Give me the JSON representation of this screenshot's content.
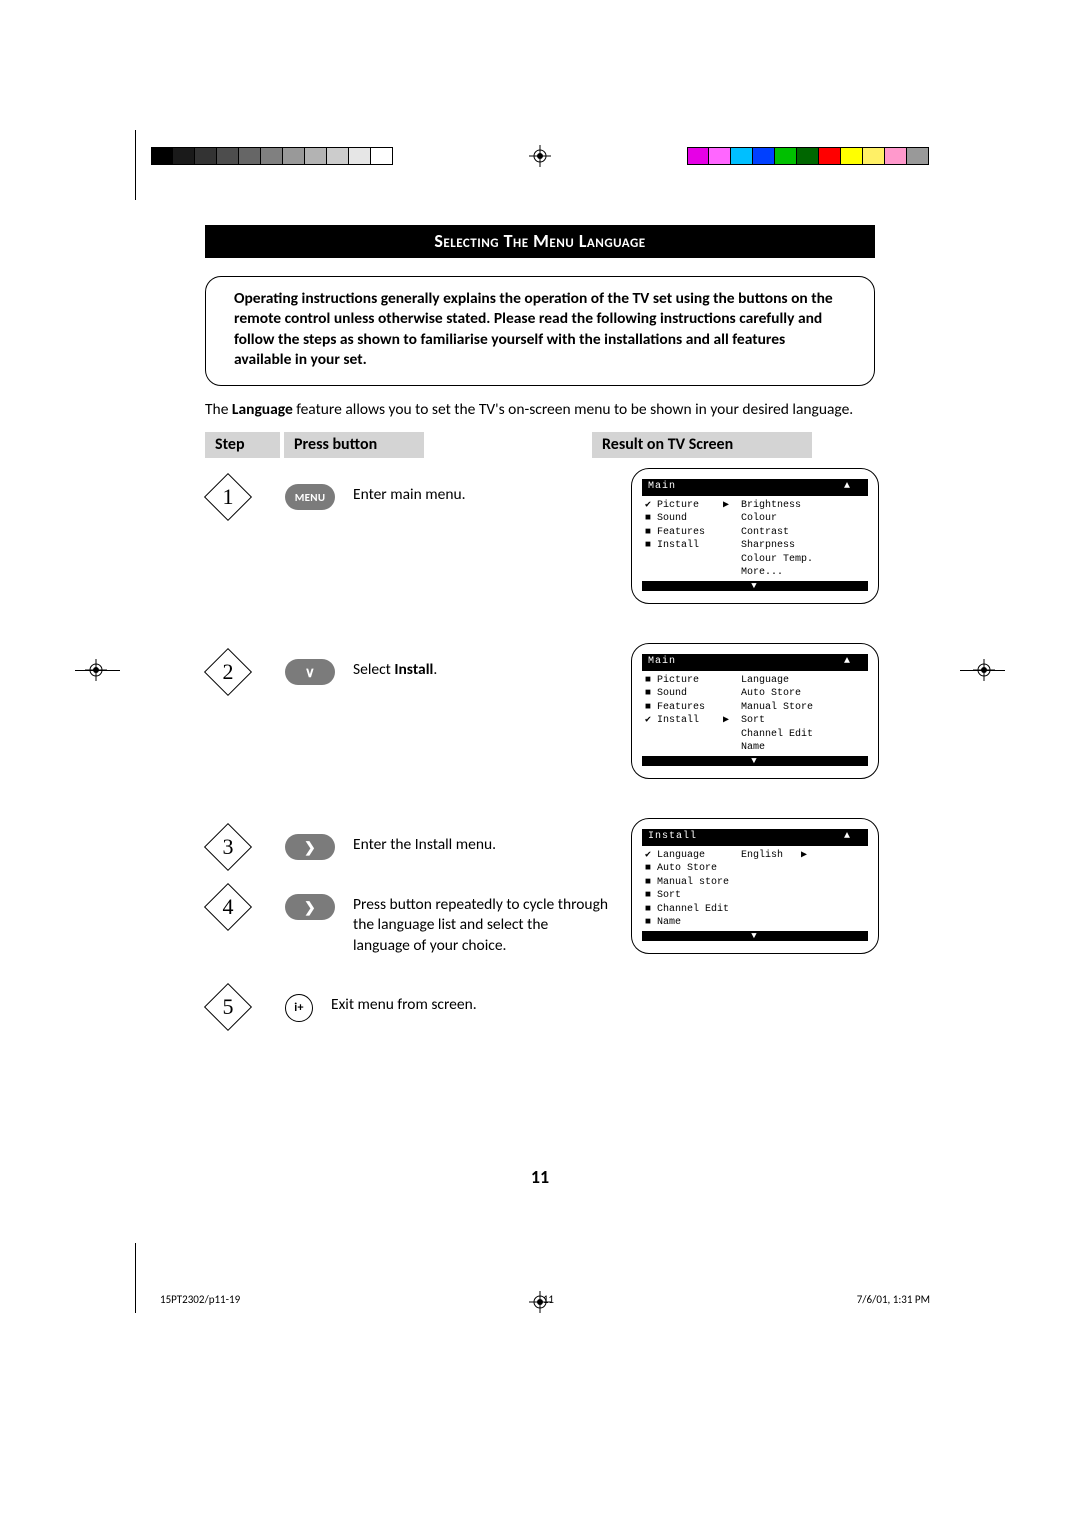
{
  "title": "Selecting The Menu Language",
  "notice": "Operating instructions generally explains the operation of the TV set using the buttons on the remote control unless otherwise stated. Please read the following instructions carefully and follow the steps as shown to familiarise yourself with the installations and all features available in your set.",
  "intro_pre": "The ",
  "intro_bold": "Language",
  "intro_post": " feature allows you to set the TV's on-screen menu to be shown in your desired language.",
  "headers": {
    "step": "Step",
    "press": "Press button",
    "result": "Result on TV Screen"
  },
  "steps": {
    "s1": {
      "num": "1",
      "btn": "MENU",
      "desc": "Enter main menu."
    },
    "s2": {
      "num": "2",
      "btn": "∨",
      "desc_pre": "Select ",
      "desc_bold": "Install",
      "desc_post": "."
    },
    "s3": {
      "num": "3",
      "btn": "❯",
      "desc": "Enter the Install menu."
    },
    "s4": {
      "num": "4",
      "btn": "❯",
      "desc": "Press button repeatedly to cycle through the language list and select the language of your choice."
    },
    "s5": {
      "num": "5",
      "btn": "i+",
      "desc": "Exit menu from screen."
    }
  },
  "tv1": {
    "title": "Main",
    "left": [
      "Picture",
      "Sound",
      "Features",
      "Install"
    ],
    "sel": 0,
    "right": [
      "Brightness",
      "Colour",
      "Contrast",
      "Sharpness",
      "Colour Temp.",
      "More..."
    ]
  },
  "tv2": {
    "title": "Main",
    "left": [
      "Picture",
      "Sound",
      "Features",
      "Install"
    ],
    "sel": 3,
    "right": [
      "Language",
      "Auto Store",
      "Manual Store",
      "Sort",
      "Channel Edit",
      "Name"
    ]
  },
  "tv3": {
    "title": "Install",
    "left": [
      "Language",
      "Auto Store",
      "Manual store",
      "Sort",
      "Channel Edit",
      "Name"
    ],
    "sel": 0,
    "rightSel": "English"
  },
  "page_number": "11",
  "footer": {
    "left": "15PT2302/p11-19",
    "center": "11",
    "right": "7/6/01, 1:31 PM"
  }
}
